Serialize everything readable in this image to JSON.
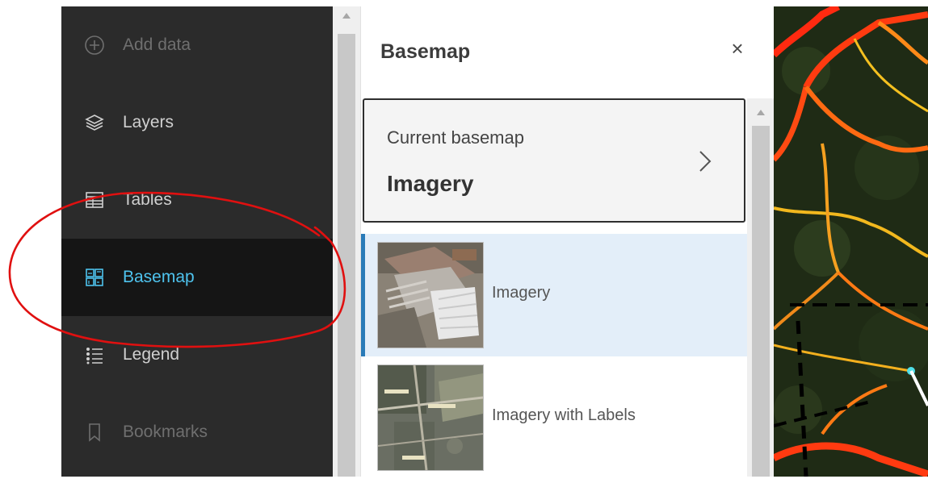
{
  "sidebar": {
    "items": [
      {
        "label": "Add data",
        "icon": "add-circle-icon",
        "state": "disabled"
      },
      {
        "label": "Layers",
        "icon": "layers-icon",
        "state": "normal"
      },
      {
        "label": "Tables",
        "icon": "table-icon",
        "state": "normal"
      },
      {
        "label": "Basemap",
        "icon": "basemap-icon",
        "state": "active"
      },
      {
        "label": "Legend",
        "icon": "legend-icon",
        "state": "normal"
      },
      {
        "label": "Bookmarks",
        "icon": "bookmark-icon",
        "state": "disabled"
      }
    ]
  },
  "panel": {
    "title": "Basemap",
    "close_icon": "close-icon",
    "current_label": "Current basemap",
    "current_value": "Imagery",
    "items": [
      {
        "label": "Imagery",
        "selected": true
      },
      {
        "label": "Imagery with Labels",
        "selected": false
      }
    ]
  },
  "colors": {
    "sidebar_bg": "#2b2b2b",
    "sidebar_active_bg": "#151515",
    "accent": "#4ec3ee",
    "selected_item_bg": "#e3eef9",
    "selected_indicator": "#2a7bb8",
    "annotation": "#e01010"
  }
}
